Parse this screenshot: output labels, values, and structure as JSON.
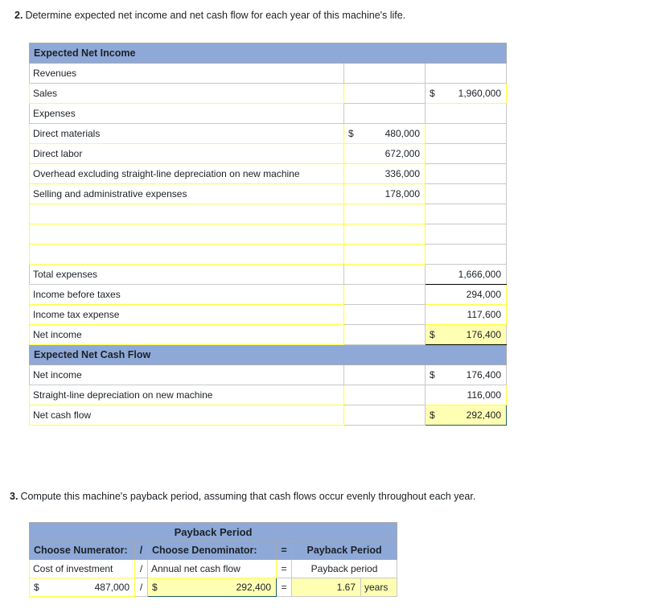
{
  "questions": {
    "q2": {
      "number": "2.",
      "text": "Determine expected net income and net cash flow for each year of this machine's life."
    },
    "q3": {
      "number": "3.",
      "text": "Compute this machine's payback period, assuming that cash flows occur evenly throughout each year."
    }
  },
  "colors": {
    "header_blue": "#8EA9D8",
    "input_border_yellow": "#FFFF33",
    "result_fill_yellow": "#FFFFB3",
    "selected_border": "#1F5C63",
    "grid_line": "#C8C8C8"
  },
  "net_income_table": {
    "section_1_title": "Expected Net Income",
    "section_2_title": "Expected Net Cash Flow",
    "rows": [
      {
        "label": "Revenues",
        "mid_cur": "",
        "mid": "",
        "right_cur": "",
        "right": ""
      },
      {
        "label": "Sales",
        "mid_cur": "",
        "mid": "",
        "right_cur": "$",
        "right": "1,960,000"
      },
      {
        "label": "Expenses",
        "mid_cur": "",
        "mid": "",
        "right_cur": "",
        "right": ""
      },
      {
        "label": "Direct materials",
        "mid_cur": "$",
        "mid": "480,000",
        "right_cur": "",
        "right": ""
      },
      {
        "label": "Direct labor",
        "mid_cur": "",
        "mid": "672,000",
        "right_cur": "",
        "right": ""
      },
      {
        "label": "Overhead excluding straight-line depreciation on new machine",
        "mid_cur": "",
        "mid": "336,000",
        "right_cur": "",
        "right": ""
      },
      {
        "label": "Selling and administrative expenses",
        "mid_cur": "",
        "mid": "178,000",
        "right_cur": "",
        "right": ""
      },
      {
        "label": "",
        "mid_cur": "",
        "mid": "",
        "right_cur": "",
        "right": ""
      },
      {
        "label": "",
        "mid_cur": "",
        "mid": "",
        "right_cur": "",
        "right": ""
      },
      {
        "label": "",
        "mid_cur": "",
        "mid": "",
        "right_cur": "",
        "right": ""
      },
      {
        "label": "Total expenses",
        "mid_cur": "",
        "mid": "",
        "right_cur": "",
        "right": "1,666,000"
      },
      {
        "label": "Income before taxes",
        "mid_cur": "",
        "mid": "",
        "right_cur": "",
        "right": "294,000"
      },
      {
        "label": "Income tax expense",
        "mid_cur": "",
        "mid": "",
        "right_cur": "",
        "right": "117,600"
      },
      {
        "label": "Net income",
        "mid_cur": "",
        "mid": "",
        "right_cur": "$",
        "right": "176,400"
      },
      {
        "label": "Net income",
        "mid_cur": "",
        "mid": "",
        "right_cur": "$",
        "right": "176,400"
      },
      {
        "label": "Straight-line depreciation on new machine",
        "mid_cur": "",
        "mid": "",
        "right_cur": "",
        "right": "116,000"
      },
      {
        "label": "Net cash flow",
        "mid_cur": "",
        "mid": "",
        "right_cur": "$",
        "right": "292,400"
      }
    ]
  },
  "payback_table": {
    "title": "Payback Period",
    "headers": {
      "numerator": "Choose Numerator:",
      "slash": "/",
      "denominator": "Choose Denominator:",
      "equals": "=",
      "result": "Payback Period"
    },
    "formula_row": {
      "numerator": "Cost of investment",
      "slash": "/",
      "denominator": "Annual net cash flow",
      "equals": "=",
      "result": "Payback period"
    },
    "value_row": {
      "numerator_cur": "$",
      "numerator": "487,000",
      "slash": "/",
      "denominator_cur": "$",
      "denominator": "292,400",
      "equals": "=",
      "result": "1.67",
      "unit": "years"
    }
  }
}
